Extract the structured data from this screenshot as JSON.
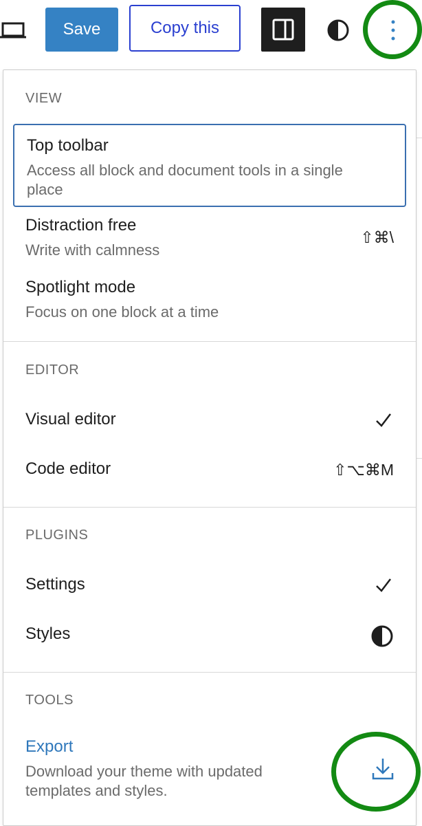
{
  "toolbar": {
    "save_label": "Save",
    "copy_label": "Copy this",
    "icons": [
      "laptop-icon",
      "sidebar-toggle-icon",
      "styles-contrast-icon",
      "more-options-icon"
    ]
  },
  "menu": {
    "view": {
      "title": "VIEW",
      "items": [
        {
          "label": "Top toolbar",
          "description": "Access all block and document tools in a single place",
          "shortcut": ""
        },
        {
          "label": "Distraction free",
          "description": "Write with calmness",
          "shortcut": "⇧⌘\\"
        },
        {
          "label": "Spotlight mode",
          "description": "Focus on one block at a time",
          "shortcut": ""
        }
      ]
    },
    "editor": {
      "title": "EDITOR",
      "items": [
        {
          "label": "Visual editor",
          "checked": true
        },
        {
          "label": "Code editor",
          "shortcut": "⇧⌥⌘M"
        }
      ]
    },
    "plugins": {
      "title": "PLUGINS",
      "items": [
        {
          "label": "Settings",
          "checked": true
        },
        {
          "label": "Styles",
          "icon": "contrast-icon"
        }
      ]
    },
    "tools": {
      "title": "TOOLS",
      "items": [
        {
          "label": "Export",
          "description": "Download your theme with updated templates and styles.",
          "icon": "download-icon"
        }
      ]
    }
  },
  "colors": {
    "accent": "#3582c4",
    "annotation": "#138a13",
    "link": "#2f78bb"
  }
}
